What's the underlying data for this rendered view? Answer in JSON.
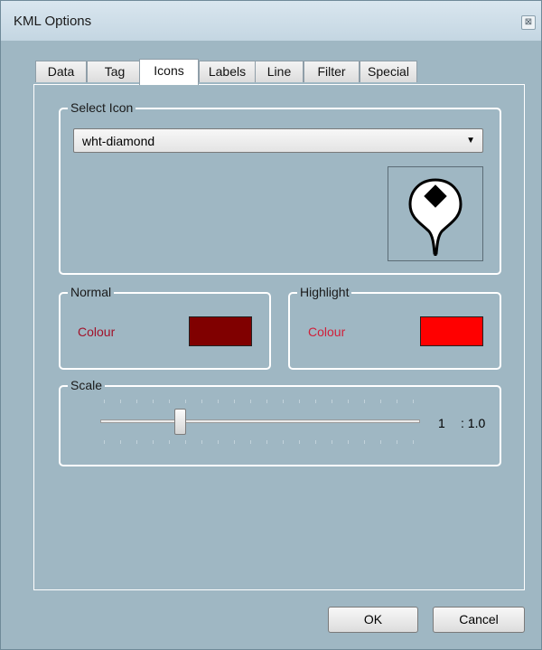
{
  "window": {
    "title": "KML Options",
    "close_symbol": "⊠"
  },
  "tabs": [
    {
      "label": "Data"
    },
    {
      "label": "Tag"
    },
    {
      "label": "Icons",
      "active": true
    },
    {
      "label": "Labels"
    },
    {
      "label": "Line"
    },
    {
      "label": "Filter"
    },
    {
      "label": "Special"
    }
  ],
  "select_icon": {
    "group_label": "Select Icon",
    "selected": "wht-diamond",
    "preview_icon": "white-diamond-placemark-icon"
  },
  "normal": {
    "group_label": "Normal",
    "colour_label": "Colour",
    "colour": "#800000"
  },
  "highlight": {
    "group_label": "Highlight",
    "colour_label": "Colour",
    "colour": "#ff0000"
  },
  "scale": {
    "group_label": "Scale",
    "value": "1",
    "ratio": ": 1.0",
    "slider_fraction": 0.25
  },
  "buttons": {
    "ok": "OK",
    "cancel": "Cancel"
  }
}
